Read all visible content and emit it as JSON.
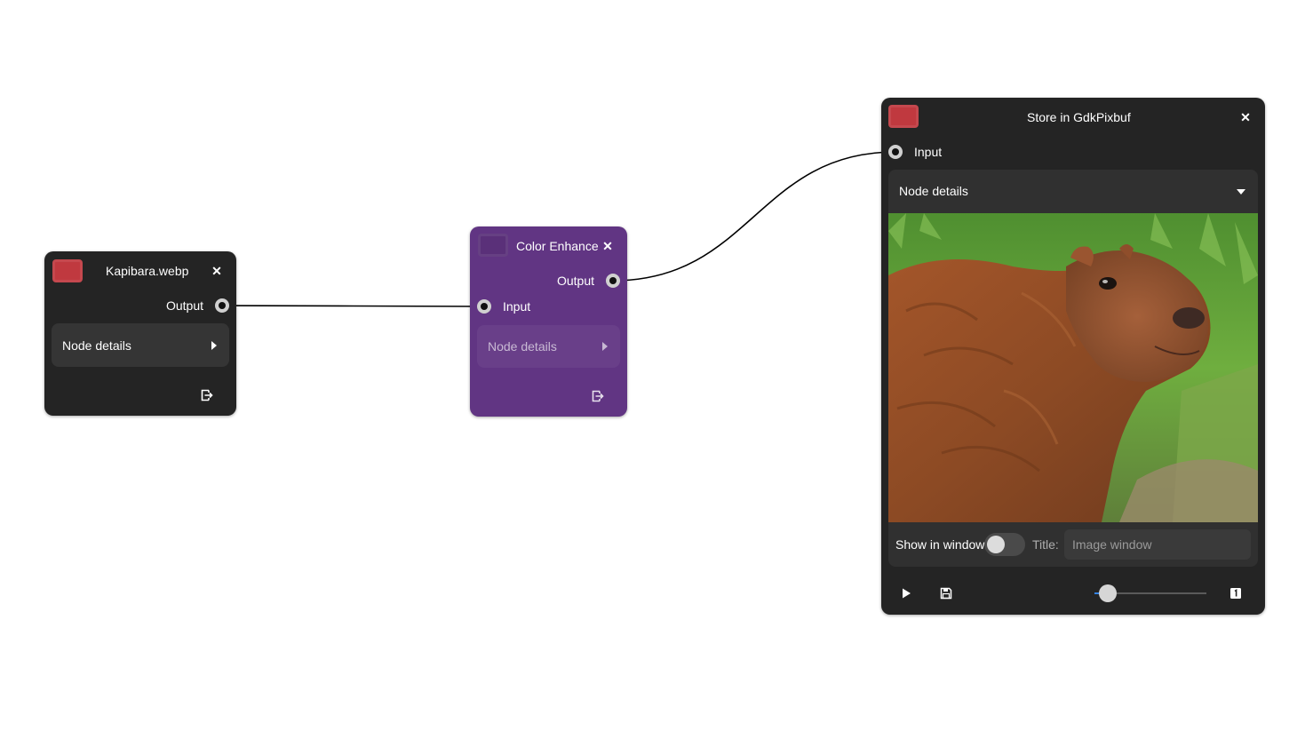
{
  "canvas": {
    "background": "#ffffff",
    "wire_color": "#000000"
  },
  "nodes": {
    "kapibara": {
      "title": "Kapibara.webp",
      "color": "#c0393f",
      "output_label": "Output",
      "details_label": "Node details",
      "close_icon": "close-icon",
      "export_icon": "export-icon"
    },
    "color_enhance": {
      "title": "Color Enhance",
      "color": "#613583",
      "output_label": "Output",
      "input_label": "Input",
      "details_label": "Node details",
      "close_icon": "close-icon",
      "export_icon": "export-icon"
    },
    "store": {
      "title": "Store in GdkPixbuf",
      "color": "#c0393f",
      "input_label": "Input",
      "details_label": "Node details",
      "preview_image": "capybara photo",
      "show_in_window_label": "Show in window",
      "show_in_window": false,
      "title_label": "Title:",
      "title_placeholder": "Image window",
      "title_value": "",
      "play_icon": "play-icon",
      "save_icon": "save-icon",
      "zoom_fraction": 0.05,
      "zoom_reset_icon": "one-to-one-icon"
    }
  }
}
